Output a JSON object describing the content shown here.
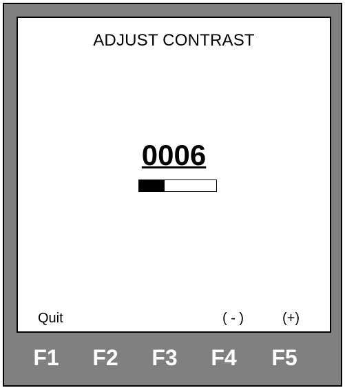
{
  "screen": {
    "title": "ADJUST CONTRAST",
    "value": "0006",
    "level_fraction": 0.33
  },
  "softkeys": {
    "f1_label": "Quit",
    "f4_label": "( - )",
    "f5_label": "(+)"
  },
  "function_keys": [
    "F1",
    "F2",
    "F3",
    "F4",
    "F5"
  ],
  "colors": {
    "bezel": "#808080",
    "screen": "#ffffff",
    "text": "#000000",
    "key_text": "#ffffff"
  }
}
